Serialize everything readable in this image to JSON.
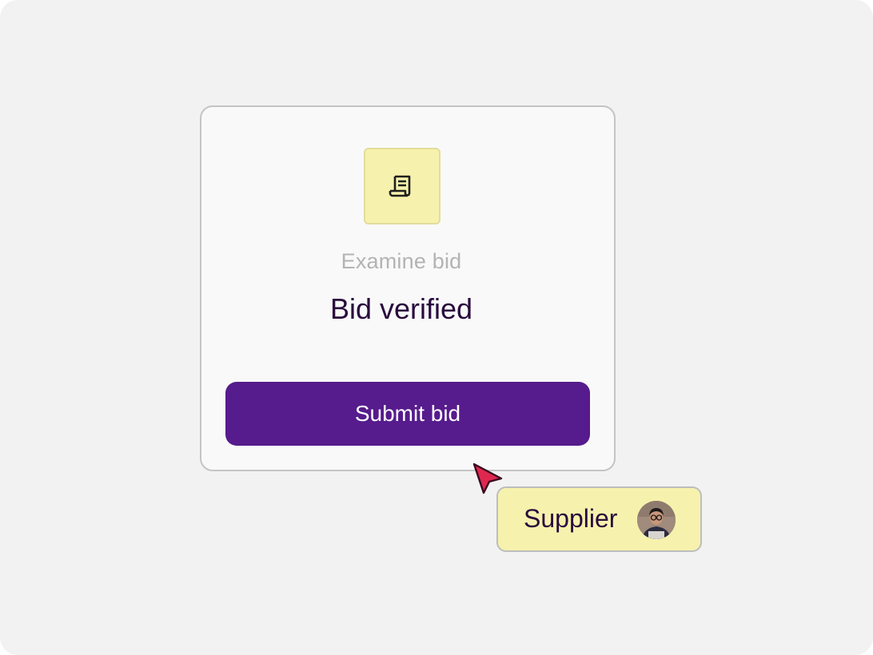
{
  "card": {
    "icon": "receipt-document-icon",
    "subtitle": "Examine bid",
    "title": "Bid verified",
    "submit_label": "Submit bid"
  },
  "cursor": {
    "icon": "pointer-cursor-icon",
    "color": "#e0284f"
  },
  "supplier_tag": {
    "label": "Supplier",
    "avatar": "person-avatar"
  },
  "colors": {
    "background": "#f2f2f2",
    "card": "#f9f9f9",
    "accent": "#561b8c",
    "highlight": "#f6f2ad",
    "text_dark": "#2a0a3d",
    "text_muted": "#b3b3b3"
  }
}
